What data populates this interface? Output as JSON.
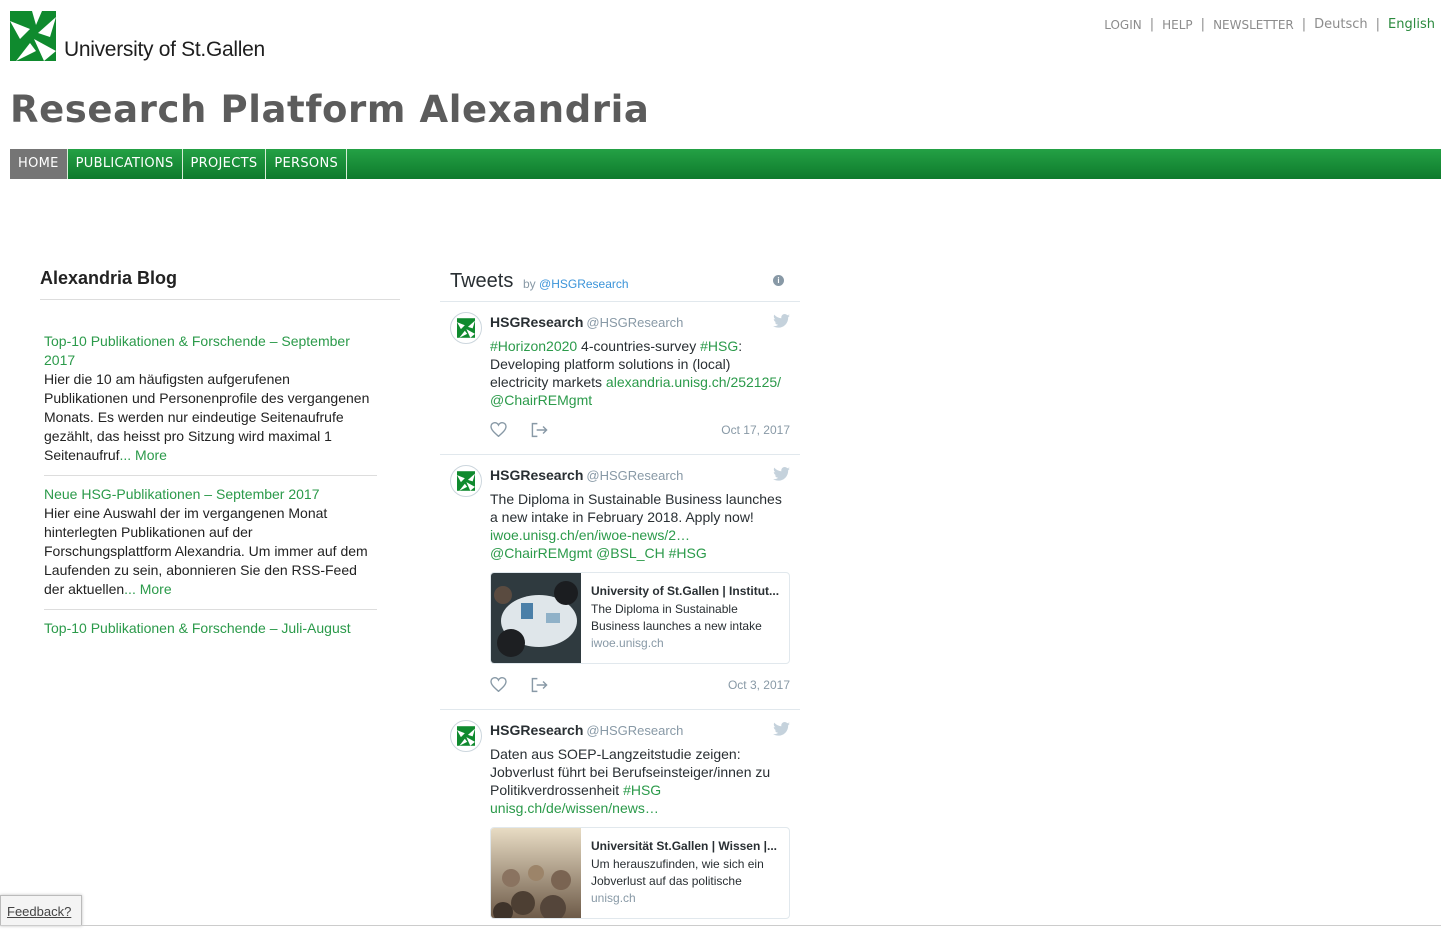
{
  "header": {
    "logo_text": "University of St.Gallen",
    "site_title": "Research Platform Alexandria",
    "top_links": [
      "LOGIN",
      "HELP",
      "NEWSLETTER"
    ],
    "languages": [
      "Deutsch",
      "English"
    ],
    "active_language": "English"
  },
  "nav": {
    "items": [
      "HOME",
      "PUBLICATIONS",
      "PROJECTS",
      "PERSONS"
    ],
    "active": "HOME"
  },
  "blog": {
    "title": "Alexandria Blog",
    "posts": [
      {
        "title": "Top-10 Publikationen & Forschende – September 2017",
        "text": "Hier die 10 am häufigsten aufgerufenen Publikationen und Personenprofile des vergangenen Monats. Es werden nur eindeutige Seitenaufrufe gezählt, das heisst pro Sitzung wird maximal 1 Seitenaufruf",
        "more": "... More"
      },
      {
        "title": "Neue HSG-Publikationen – September 2017",
        "text": "Hier eine Auswahl der im vergangenen Monat hinterlegten Publikationen auf der Forschungsplattform Alexandria. Um immer auf dem Laufenden zu sein, abonnieren Sie den RSS-Feed der aktuellen",
        "more": "... More"
      },
      {
        "title": "Top-10 Publikationen & Forschende – Juli-August",
        "text": "",
        "more": ""
      }
    ]
  },
  "tweets": {
    "title": "Tweets",
    "by": "by",
    "account": "@HSGResearch",
    "items": [
      {
        "name": "HSGResearch",
        "handle": "@HSGResearch",
        "segments": [
          {
            "t": "#Horizon2020",
            "link": true
          },
          {
            "t": " 4-countries-survey ",
            "link": false
          },
          {
            "t": "#HSG",
            "link": true
          },
          {
            "t": ": Developing platform solutions in (local) electricity markets ",
            "link": false
          },
          {
            "t": "alexandria.unisg.ch/252125/",
            "link": true
          },
          {
            "t": " ",
            "link": false
          },
          {
            "t": "@ChairREMgmt",
            "link": true
          }
        ],
        "date": "Oct 17, 2017",
        "card": null
      },
      {
        "name": "HSGResearch",
        "handle": "@HSGResearch",
        "segments": [
          {
            "t": "The Diploma in Sustainable Business launches a new intake in February 2018. Apply now! ",
            "link": false
          },
          {
            "t": "iwoe.unisg.ch/en/iwoe-news/2…",
            "link": true
          },
          {
            "t": " ",
            "link": false
          },
          {
            "t": "@ChairREMgmt",
            "link": true
          },
          {
            "t": " ",
            "link": false
          },
          {
            "t": "@BSL_CH",
            "link": true
          },
          {
            "t": " ",
            "link": false
          },
          {
            "t": "#HSG",
            "link": true
          }
        ],
        "date": "Oct 3, 2017",
        "card": {
          "title": "University of St.Gallen | Institut...",
          "desc": "The Diploma in Sustainable Business launches a new intake",
          "domain": "iwoe.unisg.ch"
        }
      },
      {
        "name": "HSGResearch",
        "handle": "@HSGResearch",
        "segments": [
          {
            "t": "Daten aus SOEP-Langzeitstudie zeigen: Jobverlust führt bei Berufseinsteiger/innen zu Politikverdrossenheit ",
            "link": false
          },
          {
            "t": "#HSG",
            "link": true
          },
          {
            "t": " ",
            "link": false
          },
          {
            "t": "unisg.ch/de/wissen/news…",
            "link": true
          }
        ],
        "date": "",
        "card": {
          "title": "Universität St.Gallen | Wissen |...",
          "desc": "Um herauszufinden, wie sich ein Jobverlust auf das politische",
          "domain": "unisg.ch"
        }
      }
    ]
  },
  "feedback": "Feedback?",
  "colors": {
    "brand_green": "#1a8f3a",
    "link_green": "#2b9a4a",
    "title_gray": "#5c5c5c"
  },
  "icons": [
    "hsg-logo-icon",
    "info-icon",
    "twitter-bird-icon",
    "heart-icon",
    "share-icon"
  ]
}
